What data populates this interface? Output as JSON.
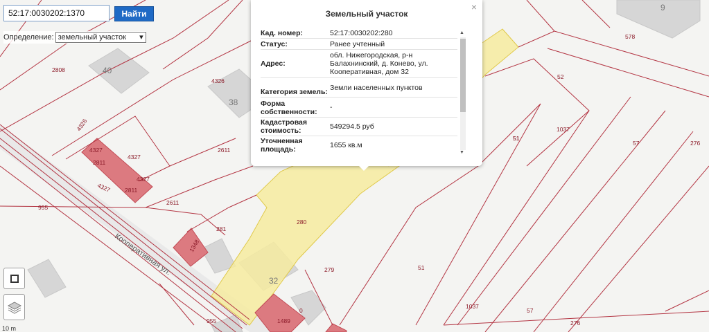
{
  "search": {
    "value": "52:17:0030202:1370",
    "button": "Найти"
  },
  "definition": {
    "label": "Определение:",
    "selected": "земельный участок"
  },
  "tools": [
    {
      "icon": "fullscreen-icon"
    },
    {
      "icon": "layers-icon"
    }
  ],
  "scale": "10 m",
  "popup": {
    "title": "Земельный участок",
    "close": "×",
    "rows": [
      {
        "key": "Кад. номер:",
        "value": "52:17:0030202:280"
      },
      {
        "key": "Статус:",
        "value": "Ранее учтенный"
      },
      {
        "key": "Адрес:",
        "value": "обл. Нижегородская, р-н Балахнинский, д. Конево, ул. Кооперативная, дом 32"
      },
      {
        "key": "Категория земель:",
        "value": "Земли населенных пунктов"
      },
      {
        "key": "Форма собственности:",
        "value": "-"
      },
      {
        "key": "Кадастровая стоимость:",
        "value": "549294.5 руб"
      },
      {
        "key": "Уточненная площадь:",
        "value": "1655 кв.м"
      }
    ]
  },
  "street": "Кооперативная ул.",
  "house_numbers": [
    "40",
    "38",
    "32",
    "9"
  ],
  "parcel_labels": [
    "2808",
    "4326",
    "4326",
    "4327",
    "4327",
    "2811",
    "4327",
    "2811",
    "4327",
    "2611",
    "2611",
    "955",
    "281",
    "1348",
    "280",
    "279",
    "51",
    "52",
    "51",
    "1037",
    "57",
    "276",
    "578",
    "51",
    "1037",
    "57",
    "276",
    "955",
    "1489",
    "0"
  ],
  "colors": {
    "parcel_line": "#b0303f",
    "selected_fill": "#f7eca0",
    "building_red": "#dc7a7f",
    "building_gray": "#d9d9d9"
  }
}
